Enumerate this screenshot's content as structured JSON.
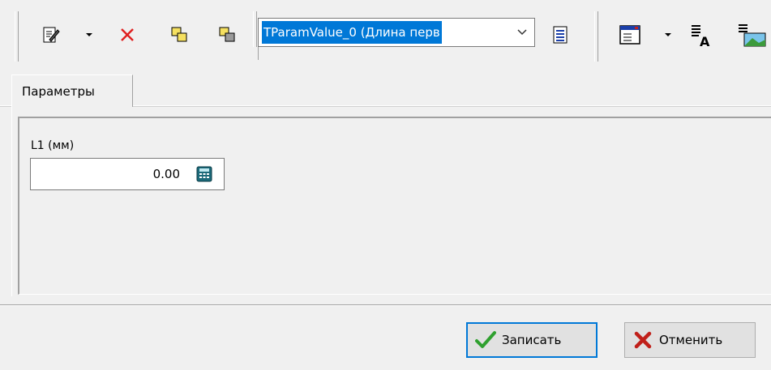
{
  "toolbar": {
    "combo_value": "TParamValue_0 (Длина перв",
    "icons": [
      "edit-icon",
      "dropdown-arrow-icon",
      "delete-icon",
      "copy-icon",
      "paste-icon",
      "combo-arrow-icon",
      "list-icon",
      "form-layout-icon",
      "text-format-icon",
      "image-format-icon"
    ]
  },
  "tabs": [
    {
      "label": "Параметры",
      "active": true
    }
  ],
  "form": {
    "field_label": "L1 (мм)",
    "field_value": "0.00",
    "field_icon": "calculator-icon"
  },
  "footer": {
    "save_label": "Записать",
    "cancel_label": "Отменить"
  },
  "colors": {
    "selection": "#0078d7",
    "delete": "#e02020",
    "save_check": "#2fa02f",
    "cancel_x": "#c0201a",
    "window_bg": "#f0f0f0"
  }
}
